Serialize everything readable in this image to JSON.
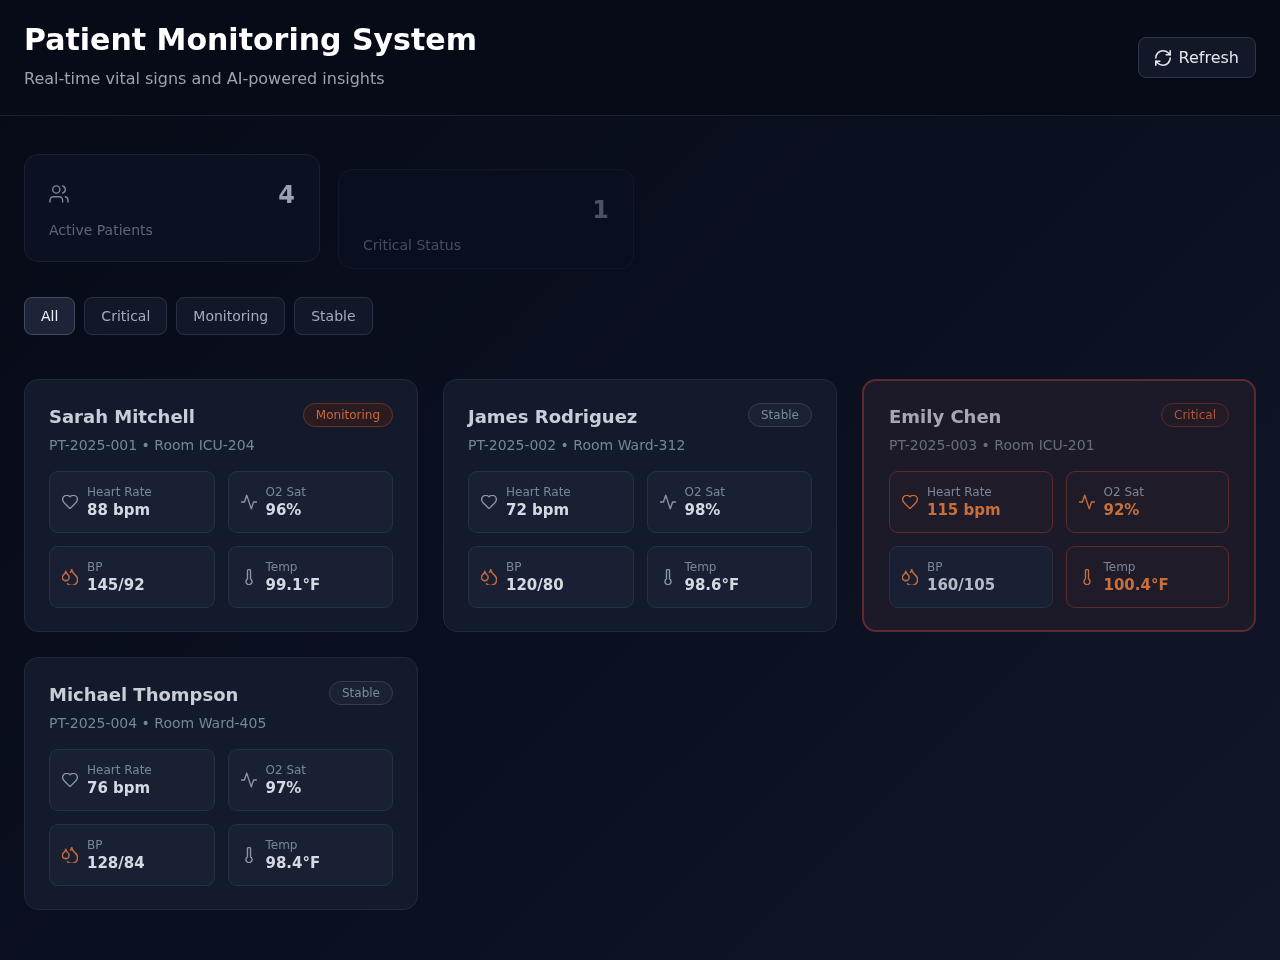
{
  "header": {
    "title": "Patient Monitoring System",
    "subtitle": "Real-time vital signs and AI-powered insights",
    "refresh_button": "Refresh"
  },
  "stats": [
    {
      "value": "4",
      "label": "Active Patients",
      "dimmed": false
    },
    {
      "value": "1",
      "label": "Critical Status",
      "dimmed": true
    }
  ],
  "filters": [
    {
      "label": "All",
      "selected": true
    },
    {
      "label": "Critical",
      "selected": false
    },
    {
      "label": "Monitoring",
      "selected": false
    },
    {
      "label": "Stable",
      "selected": false
    }
  ],
  "patients": [
    {
      "name": "Sarah Mitchell",
      "meta": "PT-2025-001 • Room ICU-204",
      "status": "Monitoring",
      "kind": "monitoring",
      "vitals": [
        {
          "kind": "heart",
          "label": "Heart Rate",
          "value": "88 bpm",
          "alert": false
        },
        {
          "kind": "o2",
          "label": "O2 Sat",
          "value": "96%",
          "alert": false
        },
        {
          "kind": "bp",
          "label": "BP",
          "value": "145/92",
          "alert": false
        },
        {
          "kind": "temp",
          "label": "Temp",
          "value": "99.1°F",
          "alert": false
        }
      ]
    },
    {
      "name": "James Rodriguez",
      "meta": "PT-2025-002 • Room Ward-312",
      "status": "Stable",
      "kind": "stable",
      "vitals": [
        {
          "kind": "heart",
          "label": "Heart Rate",
          "value": "72 bpm",
          "alert": false
        },
        {
          "kind": "o2",
          "label": "O2 Sat",
          "value": "98%",
          "alert": false
        },
        {
          "kind": "bp",
          "label": "BP",
          "value": "120/80",
          "alert": false
        },
        {
          "kind": "temp",
          "label": "Temp",
          "value": "98.6°F",
          "alert": false
        }
      ]
    },
    {
      "name": "Emily Chen",
      "meta": "PT-2025-003 • Room ICU-201",
      "status": "Critical",
      "kind": "critical",
      "vitals": [
        {
          "kind": "heart",
          "label": "Heart Rate",
          "value": "115 bpm",
          "alert": true
        },
        {
          "kind": "o2",
          "label": "O2 Sat",
          "value": "92%",
          "alert": true
        },
        {
          "kind": "bp",
          "label": "BP",
          "value": "160/105",
          "alert": false
        },
        {
          "kind": "temp",
          "label": "Temp",
          "value": "100.4°F",
          "alert": true
        }
      ]
    },
    {
      "name": "Michael Thompson",
      "meta": "PT-2025-004 • Room Ward-405",
      "status": "Stable",
      "kind": "stable",
      "vitals": [
        {
          "kind": "heart",
          "label": "Heart Rate",
          "value": "76 bpm",
          "alert": false
        },
        {
          "kind": "o2",
          "label": "O2 Sat",
          "value": "97%",
          "alert": false
        },
        {
          "kind": "bp",
          "label": "BP",
          "value": "128/84",
          "alert": false
        },
        {
          "kind": "temp",
          "label": "Temp",
          "value": "98.4°F",
          "alert": false
        }
      ]
    }
  ]
}
